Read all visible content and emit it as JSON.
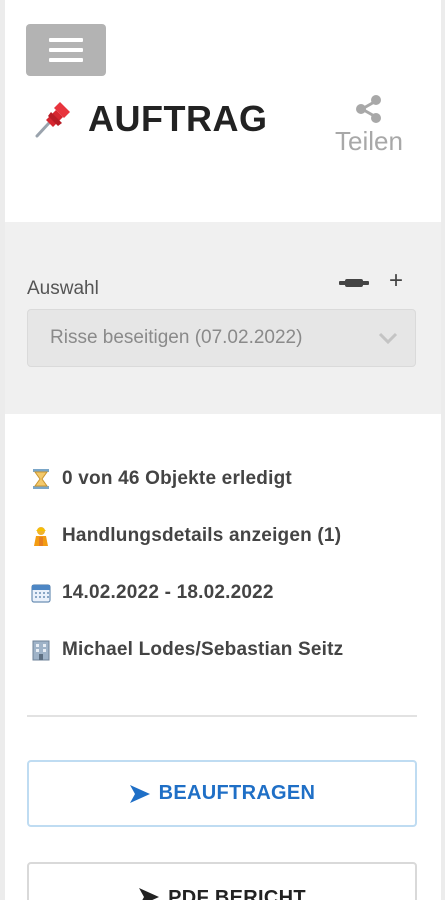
{
  "header": {
    "menu_icon": "hamburger-icon",
    "title": "AUFTRAG",
    "title_icon": "pushpin-icon",
    "share": {
      "icon": "share-icon",
      "label": "Teilen"
    }
  },
  "selection": {
    "label": "Auswahl",
    "remove_icon": "minus-icon",
    "add_label": "+",
    "selected_value": "Risse beseitigen (07.02.2022)",
    "dropdown_icon": "chevron-down-icon"
  },
  "details": [
    {
      "icon": "hourglass-icon",
      "text": "0 von 46 Objekte erledigt"
    },
    {
      "icon": "worker-icon",
      "text": "Handlungsdetails anzeigen (1)"
    },
    {
      "icon": "calendar-icon",
      "text": "14.02.2022 - 18.02.2022"
    },
    {
      "icon": "office-building-icon",
      "text": "Michael Lodes/Sebastian Seitz"
    }
  ],
  "actions": {
    "primary": {
      "icon": "arrow-right-icon",
      "label": "BEAUFTRAGEN",
      "color": "#1f6fc6"
    },
    "secondary": {
      "icon": "arrow-right-icon",
      "label": "PDF BERICHT"
    }
  }
}
